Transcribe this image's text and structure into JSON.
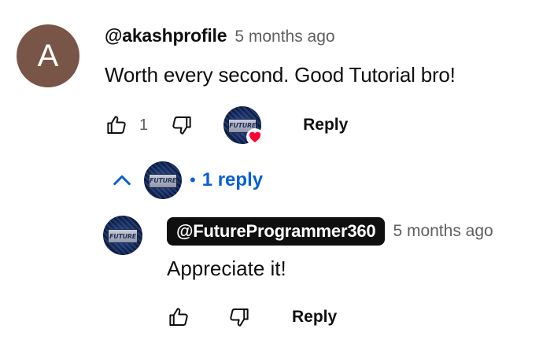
{
  "comment": {
    "avatar_letter": "A",
    "avatar_color": "#795548",
    "author": "@akashprofile",
    "time": "5 months ago",
    "text": "Worth every second. Good Tutorial bro!",
    "like_count": "1",
    "creator_avatar_text": "FUTURE",
    "reply_label": "Reply",
    "icons": {
      "like": "thumbs-up-icon",
      "dislike": "thumbs-down-icon",
      "heart": "heart-icon"
    }
  },
  "replies_toggle": {
    "dot": "•",
    "label": "1 reply",
    "avatar_text": "FUTURE",
    "icon": "chevron-up-icon",
    "color": "#065fd4"
  },
  "reply": {
    "author": "@FutureProgrammer360",
    "time": "5 months ago",
    "text": "Appreciate it!",
    "avatar_text": "FUTURE",
    "reply_label": "Reply"
  },
  "colors": {
    "heart": "#ff0033",
    "secondary_text": "#606060",
    "primary_text": "#0f0f0f"
  }
}
